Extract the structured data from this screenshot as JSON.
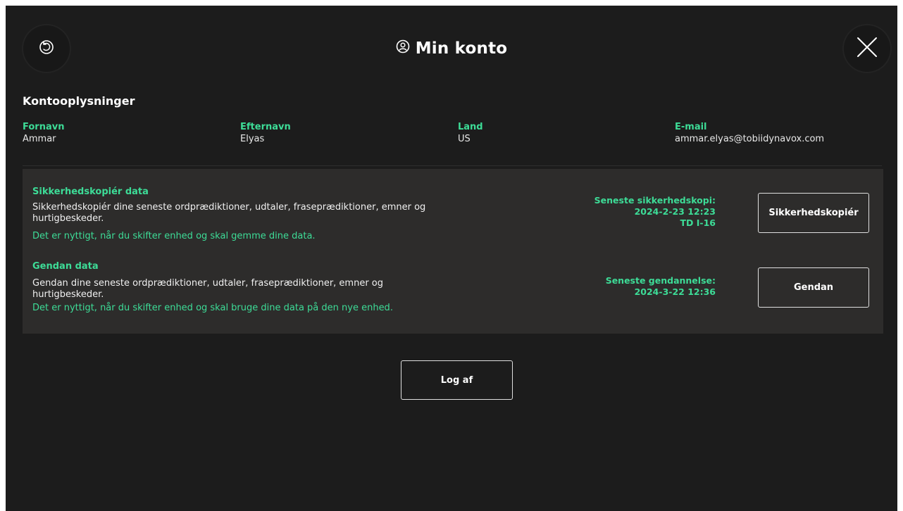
{
  "header": {
    "title": "Min konto"
  },
  "account": {
    "heading": "Kontooplysninger",
    "fields": [
      {
        "label": "Fornavn",
        "value": "Ammar"
      },
      {
        "label": "Efternavn",
        "value": "Elyas"
      },
      {
        "label": "Land",
        "value": "US"
      },
      {
        "label": "E-mail",
        "value": "ammar.elyas@tobiidynavox.com"
      }
    ]
  },
  "backup": {
    "title": "Sikkerhedskopiér data",
    "description": "Sikkerhedskopiér dine seneste ordprædiktioner, udtaler, fraseprædiktioner, emner og hurtigbeskeder.",
    "note": "Det er nyttigt, når du skifter enhed og skal gemme dine data.",
    "latest_label": "Seneste sikkerhedskopi:",
    "latest_date": "2024-2-23 12:23",
    "latest_device": "TD I-16",
    "button_label": "Sikkerhedskopiér"
  },
  "restore": {
    "title": "Gendan data",
    "description": "Gendan dine seneste ordprædiktioner, udtaler, fraseprædiktioner, emner og hurtigbeskeder.",
    "note": "Det er nyttigt, når du skifter enhed og skal bruge dine data på den nye enhed.",
    "latest_label": "Seneste gendannelse:",
    "latest_date": "2024-3-22 12:36",
    "button_label": "Gendan"
  },
  "logout": {
    "label": "Log af"
  },
  "colors": {
    "background": "#1c1c1c",
    "panel": "#2d2c2b",
    "accent": "#3ddc97"
  },
  "icons": {
    "back": "back-rotate-icon",
    "close": "close-icon",
    "user": "user-circle-icon"
  }
}
